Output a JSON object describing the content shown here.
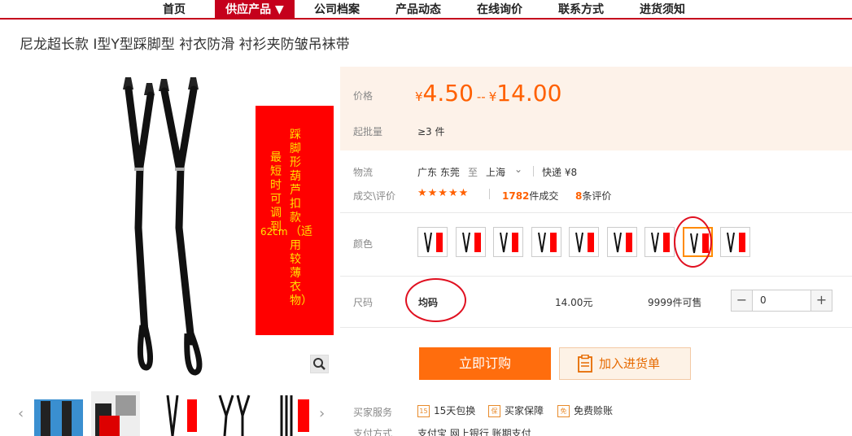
{
  "nav": {
    "items": [
      "首页",
      "供应产品 ▼",
      "公司档案",
      "产品动态",
      "在线询价",
      "联系方式",
      "进货须知"
    ],
    "active": 1,
    "accent": "#c5001c"
  },
  "product": {
    "title": "尼龙超长款 I型Y型踩脚型 衬衣防滑 衬衫夹防皱吊袜带",
    "banner_main": "踩脚形葫芦扣款（适用较薄衣物）",
    "banner_side": "最短时可调到",
    "banner_size": "62cm"
  },
  "price": {
    "label": "价格",
    "currency": "¥",
    "min": "4.50",
    "sep": "--",
    "max": "14.00",
    "moq_label": "起批量",
    "moq": "≥3 件"
  },
  "logistics": {
    "label": "物流",
    "from": "广东 东莞",
    "to_word": "至",
    "to": "上海",
    "shipping": "快递 ¥8"
  },
  "deals": {
    "label": "成交\\评价",
    "stars": "★★★★★",
    "count": "1782",
    "count_suffix": "件成交",
    "reviews": "8",
    "reviews_suffix": "条评价"
  },
  "color": {
    "label": "颜色",
    "swatch_count": 9,
    "selected": 7
  },
  "size": {
    "label": "尺码",
    "value": "均码",
    "price": "14.00元",
    "stock": "9999件可售",
    "qty": "0"
  },
  "actions": {
    "buy": "立即订购",
    "cart": "加入进货单"
  },
  "services": {
    "label": "买家服务",
    "items": [
      {
        "badge": "15",
        "text": "15天包换"
      },
      {
        "badge": "保",
        "text": "买家保障"
      },
      {
        "badge": "免",
        "text": "免费赊账"
      }
    ]
  },
  "payment": {
    "label": "支付方式",
    "methods": "支付宝  网上银行  账期支付"
  },
  "colors": {
    "accent": "#ff6000",
    "nav_red": "#c5001c",
    "banner_red": "#ff0000",
    "banner_text": "#ffe000",
    "annotation": "#e01020"
  },
  "icons": [
    "search-icon",
    "cart-list-icon",
    "minus-icon",
    "plus-icon",
    "chevron-down-icon",
    "chevron-left-icon",
    "chevron-right-icon"
  ]
}
